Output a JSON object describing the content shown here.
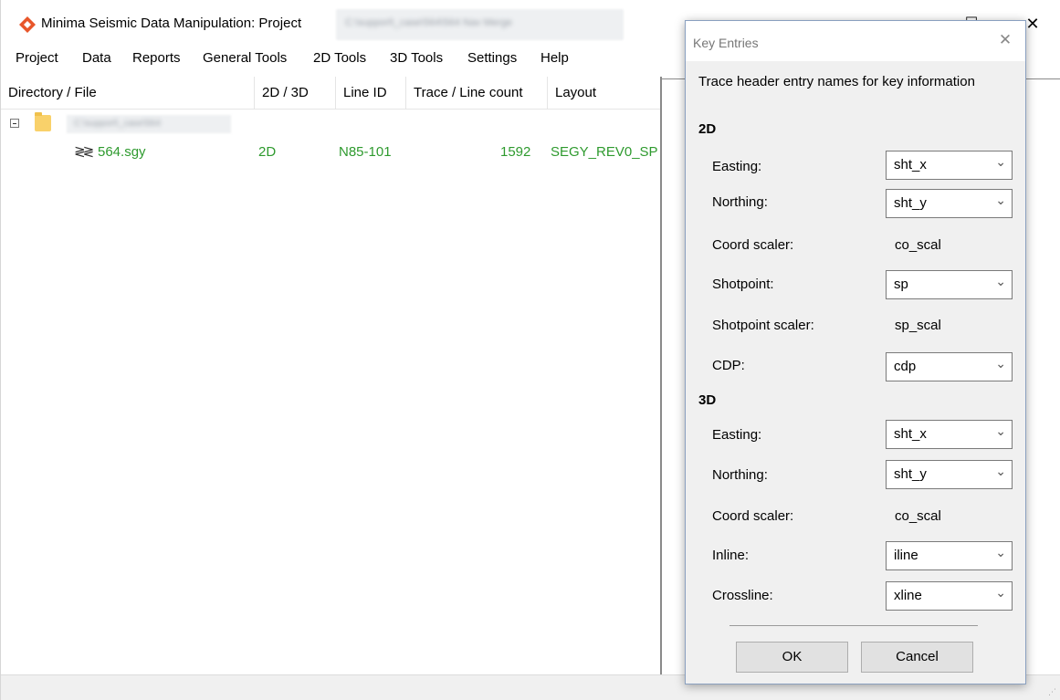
{
  "window": {
    "title": "Minima Seismic Data Manipulation: Project",
    "project_name": "C:\\support\\_case\\564\\564 Nav Merge",
    "minimize_glyph": "–",
    "maximize_glyph": "☐",
    "close_glyph": "✕"
  },
  "menu": [
    "Project",
    "Data",
    "Reports",
    "General Tools",
    "2D Tools",
    "3D Tools",
    "Settings",
    "Help"
  ],
  "table": {
    "columns": [
      "Directory / File",
      "2D / 3D",
      "Line ID",
      "Trace / Line count",
      "Layout"
    ],
    "folder": {
      "name": "C:\\support\\_case\\564",
      "expander": "minus"
    },
    "rows": [
      {
        "file": "564.sgy",
        "dim": "2D",
        "line_id": "N85-101",
        "count": "1592",
        "layout": "SEGY_REV0_SP",
        "icon": "seismic-trace-icon",
        "color": "#2e9a2e"
      }
    ]
  },
  "dialog": {
    "title": "Key Entries",
    "close_glyph": "✕",
    "heading": "Trace header entry names for key information",
    "sections": [
      {
        "label": "2D",
        "fields": [
          {
            "label": "Easting:",
            "value": "sht_x",
            "type": "combo"
          },
          {
            "label": "Northing:",
            "value": "sht_y",
            "type": "combo"
          },
          {
            "label": "Coord scaler:",
            "value": "co_scal",
            "type": "text"
          },
          {
            "label": "Shotpoint:",
            "value": "sp",
            "type": "combo"
          },
          {
            "label": "Shotpoint scaler:",
            "value": "sp_scal",
            "type": "text"
          },
          {
            "label": "CDP:",
            "value": "cdp",
            "type": "combo"
          }
        ]
      },
      {
        "label": "3D",
        "fields": [
          {
            "label": "Easting:",
            "value": "sht_x",
            "type": "combo"
          },
          {
            "label": "Northing:",
            "value": "sht_y",
            "type": "combo"
          },
          {
            "label": "Coord scaler:",
            "value": "co_scal",
            "type": "text"
          },
          {
            "label": "Inline:",
            "value": "iline",
            "type": "combo"
          },
          {
            "label": "Crossline:",
            "value": "xline",
            "type": "combo"
          }
        ]
      }
    ],
    "ok_label": "OK",
    "cancel_label": "Cancel"
  },
  "colors": {
    "file_text": "#2e9a2e",
    "brand_icon": "#e8562a",
    "folder": "#f9d16a"
  }
}
